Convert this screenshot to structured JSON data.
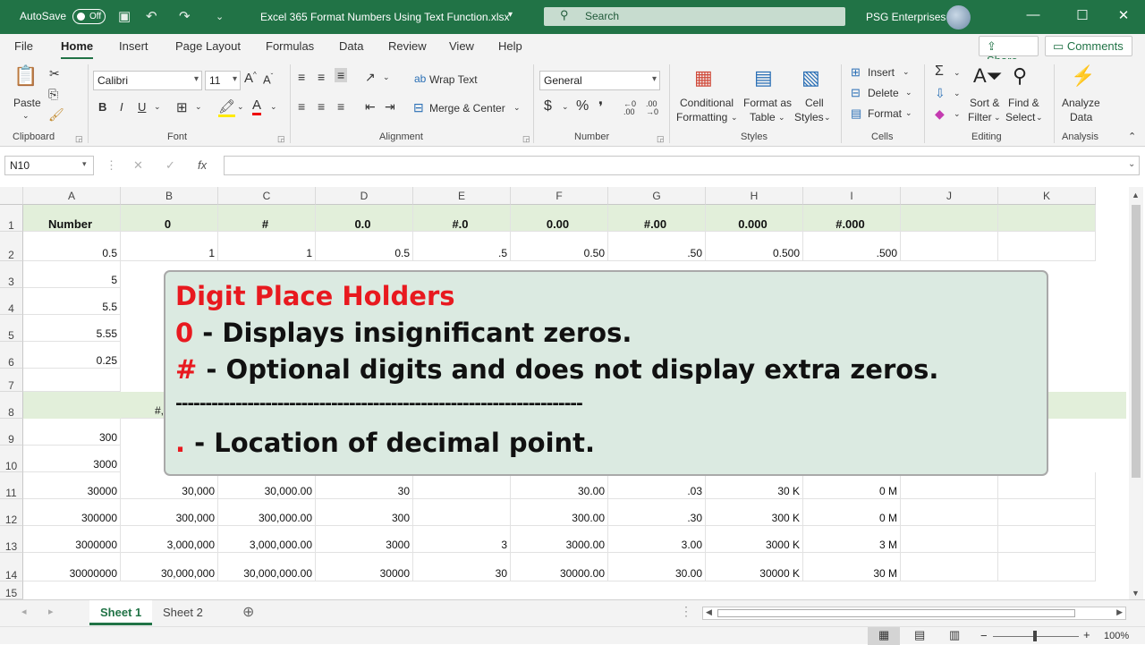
{
  "titlebar": {
    "autosave_label": "AutoSave",
    "autosave_state": "Off",
    "doc_title": "Excel 365 Format Numbers Using Text Function.xlsx",
    "search_placeholder": "Search",
    "user_name": "PSG Enterprises"
  },
  "menu": {
    "tabs": [
      "File",
      "Home",
      "Insert",
      "Page Layout",
      "Formulas",
      "Data",
      "Review",
      "View",
      "Help"
    ],
    "active": "Home",
    "share_label": "Share",
    "comments_label": "Comments"
  },
  "ribbon": {
    "clipboard": {
      "paste": "Paste",
      "group": "Clipboard"
    },
    "font": {
      "name": "Calibri",
      "size": "11",
      "bold": "B",
      "italic": "I",
      "underline": "U",
      "group": "Font"
    },
    "alignment": {
      "wrap": "Wrap Text",
      "merge": "Merge & Center",
      "group": "Alignment"
    },
    "number": {
      "format": "General",
      "group": "Number"
    },
    "styles": {
      "conditional": [
        "Conditional",
        "Formatting"
      ],
      "format_table": [
        "Format as",
        "Table"
      ],
      "cell_styles": [
        "Cell",
        "Styles"
      ],
      "group": "Styles"
    },
    "cells": {
      "insert": "Insert",
      "delete": "Delete",
      "format": "Format",
      "group": "Cells"
    },
    "editing": {
      "sort": [
        "Sort &",
        "Filter"
      ],
      "find": [
        "Find &",
        "Select"
      ],
      "group": "Editing"
    },
    "analysis": {
      "analyze": [
        "Analyze",
        "Data"
      ],
      "group": "Analysis"
    }
  },
  "formula_bar": {
    "name_box": "N10",
    "fx": "fx",
    "formula": ""
  },
  "grid": {
    "columns": [
      "A",
      "B",
      "C",
      "D",
      "E",
      "F",
      "G",
      "H",
      "I",
      "J",
      "K"
    ],
    "row_numbers": [
      "1",
      "2",
      "3",
      "4",
      "5",
      "6",
      "7",
      "8",
      "9",
      "10",
      "11",
      "12",
      "13",
      "14",
      "15"
    ],
    "header_row": [
      "Number",
      "0",
      "#",
      "0.0",
      "#.0",
      "0.00",
      "#.00",
      "0.000",
      "#.000"
    ],
    "row2": [
      "0.5",
      "1",
      "1",
      "0.5",
      ".5",
      "0.50",
      ".50",
      "0.500",
      ".500"
    ],
    "col_a_rows_3_6": [
      "5",
      "5.5",
      "5.55",
      "0.25"
    ],
    "row8_partial": "#,",
    "col_a_rows_9_10": [
      "300",
      "3000"
    ],
    "rows_11_14": [
      [
        "30000",
        "30,000",
        "30,000.00",
        "30",
        "",
        "30.00",
        ".03",
        "30 K",
        "0 M"
      ],
      [
        "300000",
        "300,000",
        "300,000.00",
        "300",
        "",
        "300.00",
        ".30",
        "300 K",
        "0 M"
      ],
      [
        "3000000",
        "3,000,000",
        "3,000,000.00",
        "3000",
        "3",
        "3000.00",
        "3.00",
        "3000 K",
        "3 M"
      ],
      [
        "30000000",
        "30,000,000",
        "30,000,000.00",
        "30000",
        "30",
        "30000.00",
        "30.00",
        "30000 K",
        "30 M"
      ]
    ]
  },
  "callout": {
    "title": "Digit Place Holders",
    "line1_symbol": "0",
    "line1_text": " - Displays insignificant zeros.",
    "line2_symbol": "#",
    "line2_text": " - Optional digits and does not display extra zeros.",
    "divider": "--------------------------------------------------------------------",
    "line3_symbol": ".",
    "line3_text": " - Location of decimal point.",
    "title_color": "#e8191f"
  },
  "sheets": {
    "tabs": [
      "Sheet 1",
      "Sheet 2"
    ],
    "active": "Sheet 1"
  },
  "status": {
    "zoom": "100%"
  }
}
